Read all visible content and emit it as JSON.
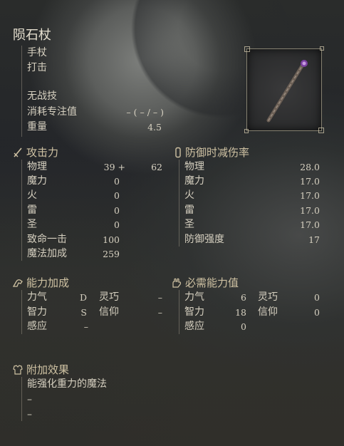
{
  "weapon": {
    "name": "陨石杖",
    "type": "手杖",
    "attack_type": "打击",
    "skill": "无战技",
    "fp_cost_label": "消耗专注值",
    "fp_cost_value": "–  (    –  /    –  )",
    "weight_label": "重量",
    "weight_value": "4.5",
    "image_icon": "meteorite-staff-icon"
  },
  "attack": {
    "header": "攻击力",
    "icon": "sword-icon",
    "rows": [
      {
        "label": "物理",
        "value": "39 +",
        "extra": "62"
      },
      {
        "label": "魔力",
        "value": "0"
      },
      {
        "label": "火",
        "value": "0"
      },
      {
        "label": "雷",
        "value": "0"
      },
      {
        "label": "圣",
        "value": "0"
      },
      {
        "label": "致命一击",
        "value": "100"
      },
      {
        "label": "魔法加成",
        "value": "259"
      }
    ]
  },
  "guard": {
    "header": "防御时减伤率",
    "icon": "shield-icon",
    "rows": [
      {
        "label": "物理",
        "value": "28.0"
      },
      {
        "label": "魔力",
        "value": "17.0"
      },
      {
        "label": "火",
        "value": "17.0"
      },
      {
        "label": "雷",
        "value": "17.0"
      },
      {
        "label": "圣",
        "value": "17.0"
      },
      {
        "label": "防御强度",
        "value": "17"
      }
    ]
  },
  "scaling": {
    "header": "能力加成",
    "icon": "arm-icon",
    "str_label": "力气",
    "str_value": "D",
    "dex_label": "灵巧",
    "dex_value": "–",
    "int_label": "智力",
    "int_value": "S",
    "fai_label": "信仰",
    "fai_value": "–",
    "arc_label": "感应",
    "arc_value": "–"
  },
  "requirements": {
    "header": "必需能力值",
    "icon": "hand-icon",
    "str_label": "力气",
    "str_value": "6",
    "dex_label": "灵巧",
    "dex_value": "0",
    "int_label": "智力",
    "int_value": "18",
    "fai_label": "信仰",
    "fai_value": "0",
    "arc_label": "感应",
    "arc_value": "0"
  },
  "effects": {
    "header": "附加效果",
    "icon": "armor-icon",
    "lines": [
      "能强化重力的魔法",
      "–",
      "–"
    ]
  },
  "colors": {
    "text": "#d6d0c0",
    "header": "#cfc2a3",
    "background": "#2a2c2b"
  }
}
